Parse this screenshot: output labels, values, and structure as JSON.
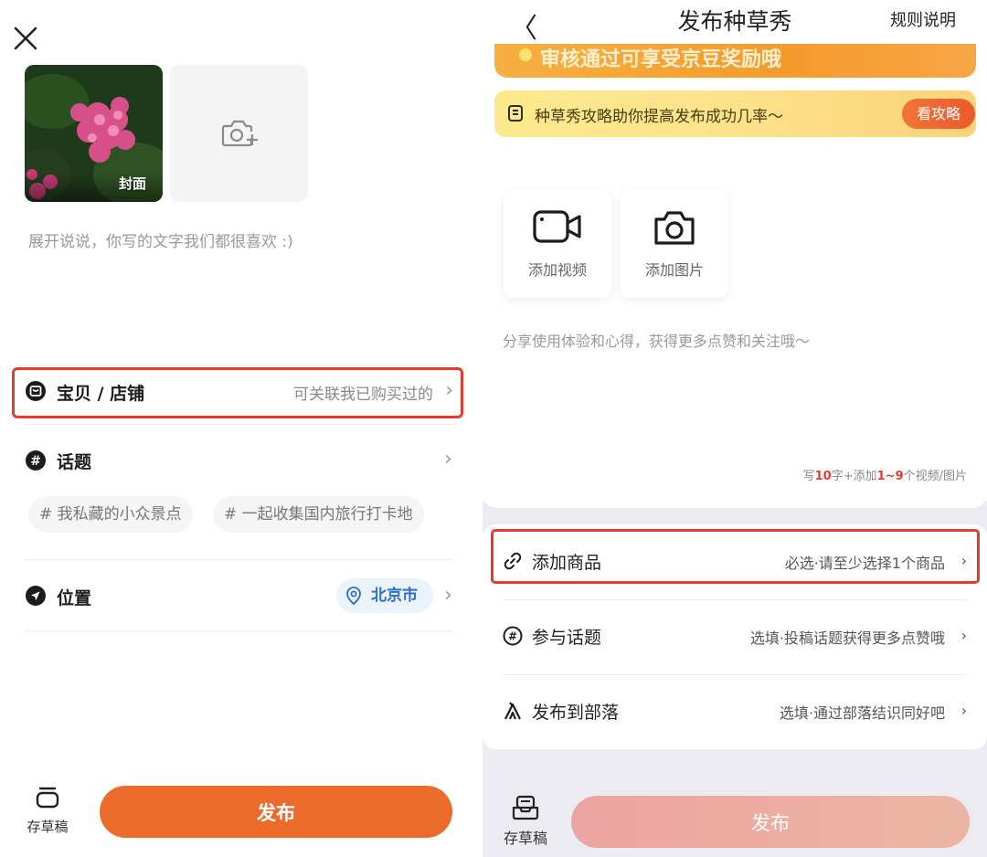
{
  "left": {
    "cover_label": "封面",
    "caption_placeholder": "展开说说，你写的文字我们都很喜欢 :)",
    "shop_row": {
      "title": "宝贝 / 店铺",
      "hint": "可关联我已购买过的"
    },
    "topic_row": {
      "title": "话题",
      "tags": [
        "# 我私藏的小众景点",
        "# 一起收集国内旅行打卡地"
      ]
    },
    "location_row": {
      "title": "位置",
      "city": "北京市"
    },
    "draft_label": "存草稿",
    "publish_label": "发布",
    "accent": "#ec6b2b"
  },
  "right": {
    "nav": {
      "back": "〈",
      "title": "发布种草秀",
      "rules": "规则说明"
    },
    "banner_top_text": "审核通过可享受京豆奖励哦",
    "guide_banner": {
      "text": "种草秀攻略助你提高发布成功几率～",
      "button": "看攻略"
    },
    "media": {
      "video_label": "添加视频",
      "image_label": "添加图片"
    },
    "share_placeholder": "分享使用体验和心得，获得更多点赞和关注哦～",
    "word_count": {
      "pre": "写",
      "n1": "10",
      "mid": "字+添加",
      "n2": "1~9",
      "post": "个视频/图片"
    },
    "rows": [
      {
        "title": "添加商品",
        "sub": "必选·请至少选择1个商品"
      },
      {
        "title": "参与话题",
        "sub": "选填·投稿话题获得更多点赞哦"
      },
      {
        "title": "发布到部落",
        "sub": "选填·通过部落结识同好吧"
      }
    ],
    "draft_label": "存草稿",
    "publish_label": "发布",
    "highlight_color": "#e63a2f"
  }
}
